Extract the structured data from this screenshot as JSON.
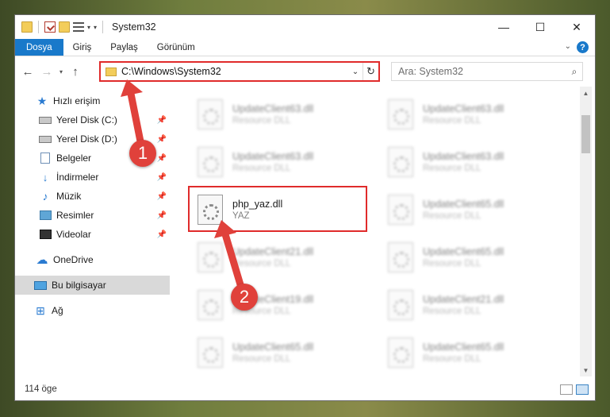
{
  "window": {
    "title": "System32",
    "controls": {
      "minimize": "—",
      "maximize": "☐",
      "close": "✕"
    }
  },
  "ribbon": {
    "tabs": [
      {
        "label": "Dosya",
        "active": true
      },
      {
        "label": "Giriş"
      },
      {
        "label": "Paylaş"
      },
      {
        "label": "Görünüm"
      }
    ],
    "help": "?"
  },
  "address": {
    "path": "C:\\Windows\\System32",
    "search_placeholder": "Ara: System32"
  },
  "sidebar": {
    "items": [
      {
        "label": "Hızlı erişim",
        "icon": "star-icon"
      },
      {
        "label": "Yerel Disk (C:)",
        "icon": "drive-icon",
        "pinned": true
      },
      {
        "label": "Yerel Disk (D:)",
        "icon": "drive-icon",
        "pinned": true
      },
      {
        "label": "Belgeler",
        "icon": "documents-icon",
        "pinned": true
      },
      {
        "label": "İndirmeler",
        "icon": "download-icon",
        "pinned": true
      },
      {
        "label": "Müzik",
        "icon": "music-icon",
        "pinned": true
      },
      {
        "label": "Resimler",
        "icon": "pictures-icon",
        "pinned": true
      },
      {
        "label": "Videolar",
        "icon": "videos-icon",
        "pinned": true
      },
      {
        "label": "OneDrive",
        "icon": "cloud-icon"
      },
      {
        "label": "Bu bilgisayar",
        "icon": "computer-icon",
        "selected": true
      },
      {
        "label": "Ağ",
        "icon": "network-icon"
      }
    ]
  },
  "files": {
    "highlighted": {
      "name": "php_yaz.dll",
      "type": "YAZ"
    },
    "blurred_left": [
      {
        "name": "UpdateClient63.dll",
        "type": "Resource DLL"
      },
      {
        "name": "UpdateClient63.dll",
        "type": "Resource DLL"
      },
      {
        "name": "UpdateClient21.dll",
        "type": "Resource DLL"
      },
      {
        "name": "UpdateClient19.dll",
        "type": "Resource DLL"
      },
      {
        "name": "UpdateClient65.dll",
        "type": "Resource DLL"
      }
    ],
    "blurred_right": [
      {
        "name": "UpdateClient63.dll",
        "type": "Resource DLL"
      },
      {
        "name": "UpdateClient63.dll",
        "type": "Resource DLL"
      },
      {
        "name": "UpdateClient65.dll",
        "type": "Resource DLL"
      },
      {
        "name": "UpdateClient65.dll",
        "type": "Resource DLL"
      },
      {
        "name": "UpdateClient21.dll",
        "type": "Resource DLL"
      },
      {
        "name": "UpdateClient65.dll",
        "type": "Resource DLL"
      }
    ]
  },
  "status": {
    "count": "114 öge"
  },
  "callouts": {
    "one": "1",
    "two": "2"
  },
  "colors": {
    "accent": "#1979ca",
    "highlight": "#e02b2b",
    "callout": "#e0413b"
  }
}
